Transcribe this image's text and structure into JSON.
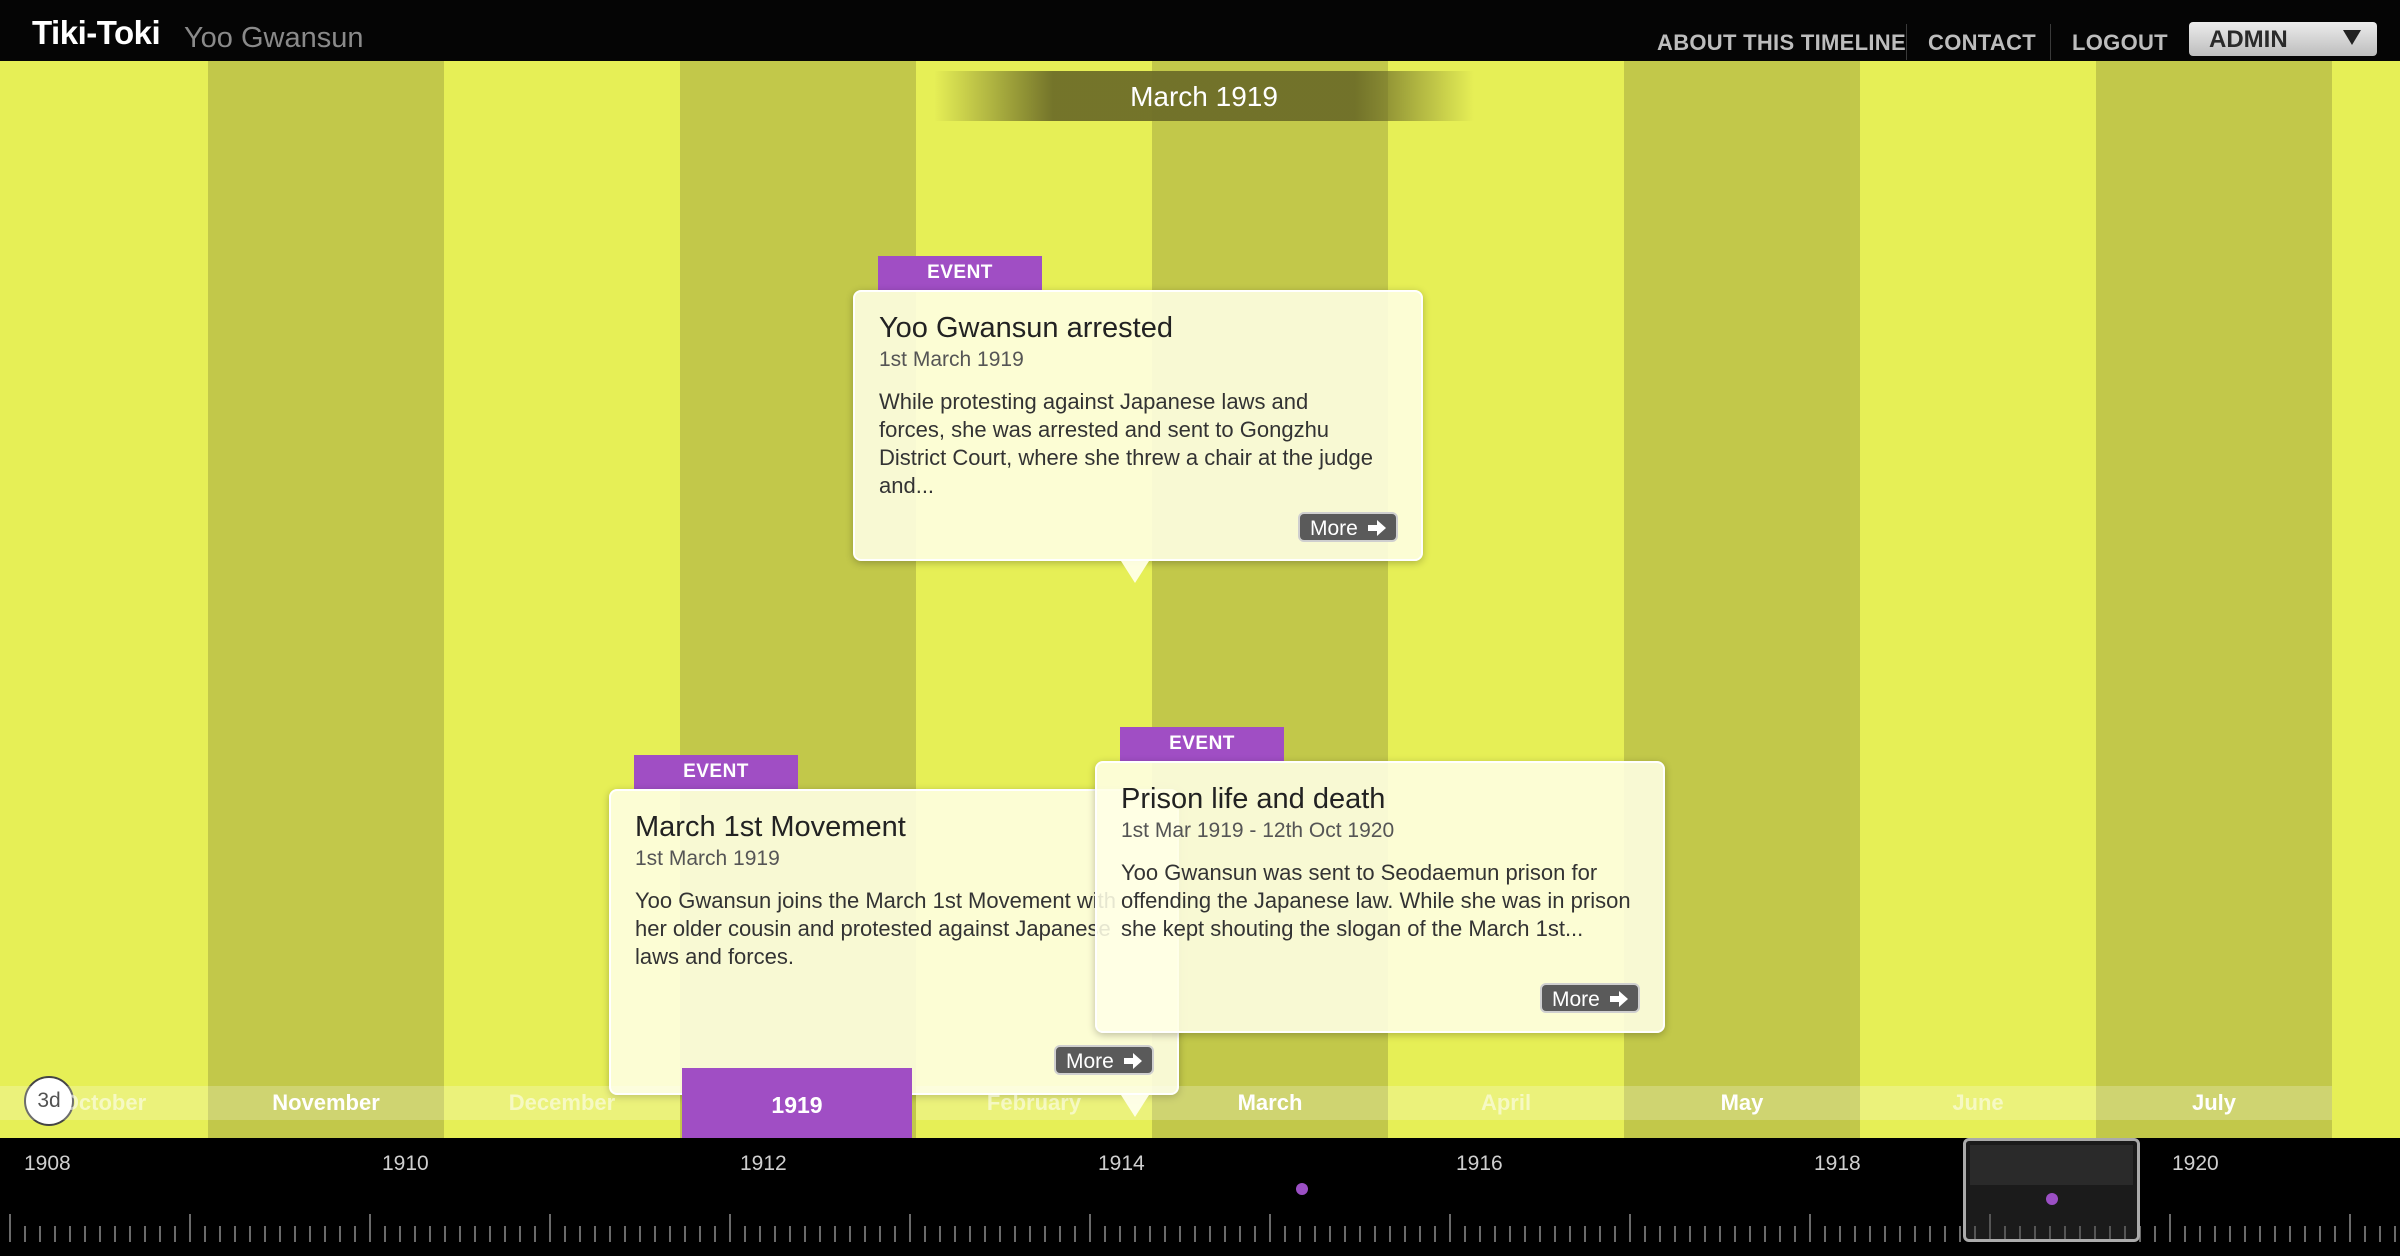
{
  "header": {
    "brand": "Tiki-Toki",
    "timeline_title": "Yoo Gwansun",
    "nav": {
      "about": "ABOUT THIS TIMELINE",
      "contact": "CONTACT",
      "logout": "LOGOUT",
      "admin": "ADMIN"
    }
  },
  "stage": {
    "current_month": "March 1919",
    "view_mode_button": "3d",
    "colors": {
      "background": "#e6ef56",
      "band": "#c2c84a",
      "accent": "#a04ec4"
    }
  },
  "events": [
    {
      "tag": "EVENT",
      "title": "Yoo Gwansun arrested",
      "date": "1st March 1919",
      "description": "While protesting against Japanese laws and forces, she was arrested and sent to Gongzhu District Court, where she threw a chair at the judge and...",
      "more_label": "More"
    },
    {
      "tag": "EVENT",
      "title": "March 1st Movement",
      "date": "1st March 1919",
      "description": "Yoo Gwansun joins the March 1st Movement with her older cousin and protested against Japanese laws and forces.",
      "more_label": "More"
    },
    {
      "tag": "EVENT",
      "title": "Prison life and death",
      "date": "1st Mar 1919 - 12th Oct 1920",
      "description": "Yoo Gwansun was sent to Seodaemun prison for offending the Japanese law. While she was in prison she kept shouting the slogan of the March 1st...",
      "more_label": "More"
    }
  ],
  "month_strip": {
    "months": [
      "October",
      "November",
      "December",
      "1919",
      "February",
      "March",
      "April",
      "May",
      "June",
      "July"
    ]
  },
  "scrubber": {
    "years": [
      "1908",
      "1910",
      "1912",
      "1914",
      "1916",
      "1918",
      "1920"
    ]
  }
}
